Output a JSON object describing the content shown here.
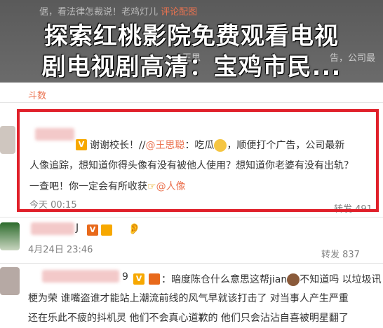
{
  "top_behind": {
    "line1": "倨，看法律怎裁说！老鸡灯儿",
    "line1_link": "评论配图",
    "line2_a": "王思",
    "line2_b": "告，公司最"
  },
  "headline": {
    "line1": "探索红桃影院免费观看电视",
    "line2": "剧电视剧高清：宝鸡市民..."
  },
  "section_label": "斗数",
  "comments": [
    {
      "text_line1_prefix": "谢谢校长！//",
      "mention1": "@王思聪",
      "text_line1_suffix": "：吃瓜",
      "text_line1_end": "，顺便打个广告，公司最新",
      "text_line2": "人像追踪，想知道你得头像有没有被他人使用？想知道你老婆有没有出轨？",
      "text_line3_prefix": "一查吧！你一定会有所收获",
      "mention2": "@人像",
      "time": "今天 00:15",
      "repost": "转发 491"
    },
    {
      "badge": "V",
      "name_suffix": "J",
      "time": "4月24日 23:46",
      "repost": "转发 837"
    },
    {
      "name_suffix": "9",
      "badge": "V",
      "text_line1": "：暗度陈仓什么意思这帮jian",
      "text_line1_end": "不知道吗 以垃圾讯",
      "text_line2": "梗为荣 谁嘴盗谁才能站上潮流前线的风气早就该打击了 对当事人产生严重",
      "text_line3": "还在乐此不疲的抖机灵 他们不会真心道歉的 他们只会沾沾自喜被明星翻了"
    }
  ]
}
